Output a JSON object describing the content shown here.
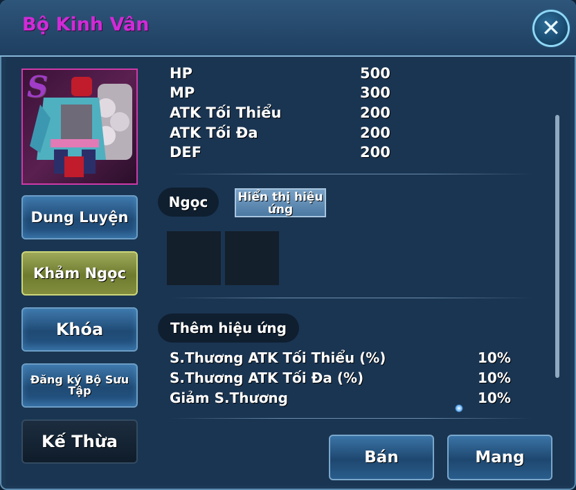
{
  "window": {
    "title": "Bộ Kinh Vân",
    "close_icon": "close-icon"
  },
  "item": {
    "grade": "S",
    "image": "armor-costume-image"
  },
  "side_buttons": [
    {
      "label": "Dung Luyện",
      "state": "normal"
    },
    {
      "label": "Khảm Ngọc",
      "state": "selected"
    },
    {
      "label": "Khóa",
      "state": "normal"
    },
    {
      "label": "Đăng ký Bộ Sưu Tập",
      "state": "normal"
    },
    {
      "label": "Kế Thừa",
      "state": "disabled"
    }
  ],
  "stats": [
    {
      "label": "HP",
      "value": "500"
    },
    {
      "label": "MP",
      "value": "300"
    },
    {
      "label": "ATK Tối Thiểu",
      "value": "200"
    },
    {
      "label": "ATK Tối Đa",
      "value": "200"
    },
    {
      "label": "DEF",
      "value": "200"
    }
  ],
  "gem_section": {
    "label": "Ngọc",
    "show_effect_button": "Hiển thị hiệu ứng",
    "slot_count": 2
  },
  "extra_effects": {
    "label": "Thêm hiệu ứng",
    "items": [
      {
        "label": "S.Thương ATK Tối Thiểu (%)",
        "value": "10%"
      },
      {
        "label": "S.Thương ATK Tối Đa (%)",
        "value": "10%"
      },
      {
        "label": "Giảm S.Thương",
        "value": "10%"
      }
    ]
  },
  "actions": {
    "sell": "Bán",
    "equip": "Mang"
  },
  "colors": {
    "title": "#d02bd7",
    "panel": "#1a3552",
    "selected_button": "#6e7b2f"
  }
}
